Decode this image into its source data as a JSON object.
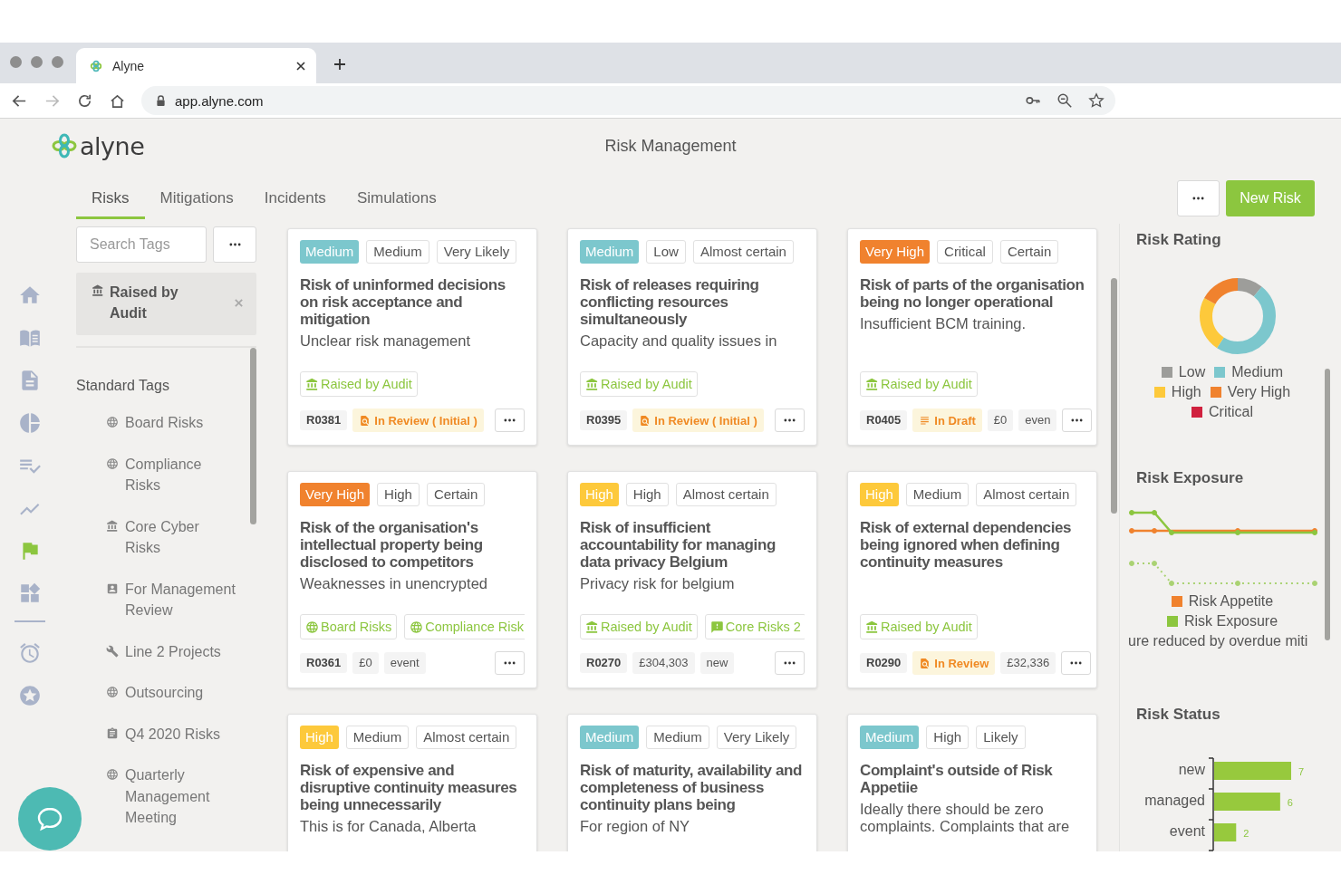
{
  "browser": {
    "tab_title": "Alyne",
    "url": "app.alyne.com"
  },
  "app": {
    "logo": "alyne",
    "title": "Risk Management"
  },
  "nav": {
    "main": [
      {
        "kind": "home",
        "selected": false
      },
      {
        "kind": "book",
        "selected": false
      },
      {
        "kind": "document",
        "selected": false
      },
      {
        "kind": "pie",
        "selected": false
      },
      {
        "kind": "checklist",
        "selected": false
      },
      {
        "kind": "trend",
        "selected": false
      },
      {
        "kind": "flag",
        "selected": true
      },
      {
        "kind": "widgets",
        "selected": false
      }
    ],
    "secondary": [
      {
        "kind": "alarm",
        "selected": false
      },
      {
        "kind": "star",
        "selected": false
      }
    ]
  },
  "tabs": [
    {
      "label": "Risks",
      "selected": true
    },
    {
      "label": "Mitigations",
      "selected": false
    },
    {
      "label": "Incidents",
      "selected": false
    },
    {
      "label": "Simulations",
      "selected": false
    }
  ],
  "new_button": "New Risk",
  "sidebar": {
    "search": {
      "placeholder": "Search Tags"
    },
    "active_filter": {
      "label": "Raised by Audit",
      "kind": "bank"
    },
    "section_title": "Standard Tags",
    "tags": [
      {
        "label": "Board Risks",
        "kind": "globe"
      },
      {
        "label": "Compliance Risks",
        "kind": "globe"
      },
      {
        "label": "Core Cyber Risks",
        "kind": "bank"
      },
      {
        "label": "For Management Review",
        "kind": "contact"
      },
      {
        "label": "Line 2 Projects",
        "kind": "wrench"
      },
      {
        "label": "Outsourcing",
        "kind": "globe"
      },
      {
        "label": "Q4 2020 Risks",
        "kind": "clipboard"
      },
      {
        "label": "Quarterly Management Meeting",
        "kind": "globe"
      }
    ]
  },
  "cards": [
    {
      "rating": {
        "label": "Medium",
        "color": "#7cc7cd"
      },
      "chips": [
        "Medium",
        "Very Likely"
      ],
      "title": "Risk of uninformed decisions on risk acceptance and mitigation",
      "description": "Unclear risk management",
      "tags": [
        {
          "label": "Raised by Audit",
          "kind": "bank"
        }
      ],
      "id": "R0381",
      "status": {
        "label": "In Review ( Initial )",
        "kind": "review"
      }
    },
    {
      "rating": {
        "label": "Medium",
        "color": "#7cc7cd"
      },
      "chips": [
        "Low",
        "Almost certain"
      ],
      "title": "Risk of releases requiring conflicting resources simultaneously",
      "description": "Capacity and quality issues in",
      "tags": [
        {
          "label": "Raised by Audit",
          "kind": "bank"
        }
      ],
      "id": "R0395",
      "status": {
        "label": "In Review ( Initial )",
        "kind": "review"
      }
    },
    {
      "rating": {
        "label": "Very High",
        "color": "#f0822e"
      },
      "chips": [
        "Critical",
        "Certain"
      ],
      "title": "Risk of parts of the organisation being no longer operational",
      "description": "Insufficient BCM training.",
      "tags": [
        {
          "label": "Raised by Audit",
          "kind": "bank"
        }
      ],
      "id": "R0405",
      "status": {
        "label": "In Draft",
        "kind": "draft"
      },
      "extras": [
        "£0",
        "even"
      ]
    },
    {
      "rating": {
        "label": "Very High",
        "color": "#f0822e"
      },
      "chips": [
        "High",
        "Certain"
      ],
      "title": "Risk of the organisation's intellectual property being disclosed to competitors",
      "description": "Weaknesses in unencrypted",
      "tags": [
        {
          "label": "Board Risks",
          "kind": "globe"
        },
        {
          "label": "Compliance Risk",
          "kind": "globe"
        }
      ],
      "id": "R0361",
      "extras": [
        "£0",
        "event"
      ]
    },
    {
      "rating": {
        "label": "High",
        "color": "#fdc93b"
      },
      "chips": [
        "High",
        "Almost certain"
      ],
      "title": "Risk of insufficient accountability for managing data privacy Belgium",
      "description": "Privacy risk for belgium",
      "tags": [
        {
          "label": "Raised by Audit",
          "kind": "bank"
        },
        {
          "label": "Core Risks 2",
          "kind": "comment"
        }
      ],
      "id": "R0270",
      "extras": [
        "£304,303",
        "new"
      ]
    },
    {
      "rating": {
        "label": "High",
        "color": "#fdc93b"
      },
      "chips": [
        "Medium",
        "Almost certain"
      ],
      "title": "Risk of external dependencies being ignored when defining continuity measures",
      "tags": [
        {
          "label": "Raised by Audit",
          "kind": "bank"
        }
      ],
      "id": "R0290",
      "status": {
        "label": "In Review",
        "kind": "review"
      },
      "extras": [
        "£32,336"
      ]
    },
    {
      "rating": {
        "label": "High",
        "color": "#fdc93b"
      },
      "chips": [
        "Medium",
        "Almost certain"
      ],
      "title": "Risk of expensive and disruptive continuity measures being unnecessarily",
      "description": "This is for Canada, Alberta"
    },
    {
      "rating": {
        "label": "Medium",
        "color": "#7cc7cd"
      },
      "chips": [
        "Medium",
        "Very Likely"
      ],
      "title": "Risk of maturity, availability and completeness of business continuity plans being",
      "description": "For region of NY"
    },
    {
      "rating": {
        "label": "Medium",
        "color": "#7cc7cd"
      },
      "chips": [
        "High",
        "Likely"
      ],
      "title": "Complaint's outside of Risk Appetiie",
      "description": "Ideally there should be zero complaints. Complaints that are"
    }
  ],
  "right_panel": {
    "risk_rating": {
      "title": "Risk Rating",
      "legend": [
        {
          "label": "Low",
          "color": "#9d9d9a"
        },
        {
          "label": "Medium",
          "color": "#7cc7cd"
        },
        {
          "label": "High",
          "color": "#fdc93b"
        },
        {
          "label": "Very High",
          "color": "#f0822e"
        },
        {
          "label": "Critical",
          "color": "#d0213e"
        }
      ]
    },
    "risk_exposure": {
      "title": "Risk Exposure",
      "legend": [
        {
          "label": "Risk Appetite",
          "color": "#f0822e"
        },
        {
          "label": "Risk Exposure",
          "color": "#8cc63f"
        }
      ],
      "note": "ure reduced by overdue miti"
    },
    "risk_status": {
      "title": "Risk Status",
      "chart_data": {
        "type": "bar",
        "orientation": "horizontal",
        "categories": [
          "new",
          "managed",
          "event"
        ],
        "values": [
          7,
          6,
          2
        ],
        "data_labels": true
      }
    }
  }
}
